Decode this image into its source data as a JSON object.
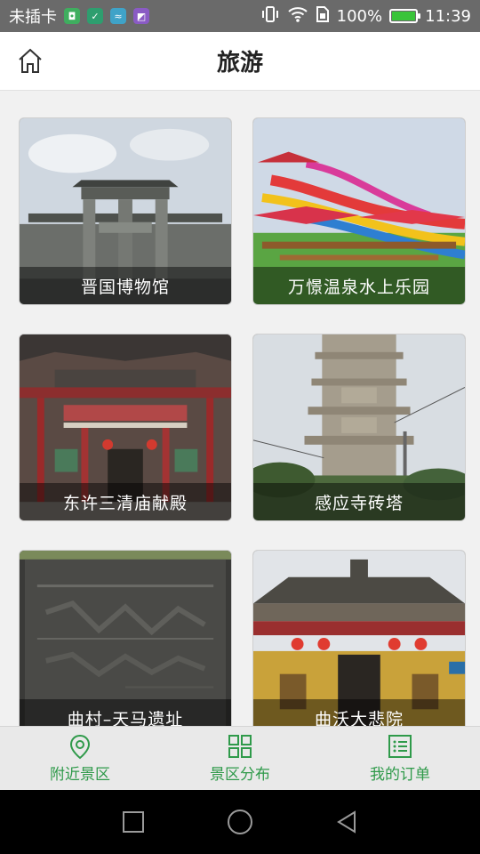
{
  "status_bar": {
    "carrier": "未插卡",
    "battery_text": "100%",
    "battery_level": 1.0,
    "time": "11:39",
    "app_icons": [
      "app-icon-green",
      "app-icon-green2",
      "app-icon-blue",
      "app-icon-purple"
    ]
  },
  "header": {
    "title": "旅游",
    "home_icon": "home-icon"
  },
  "attractions": [
    {
      "name": "晋国博物馆"
    },
    {
      "name": "万憬温泉水上乐园"
    },
    {
      "name": "东许三清庙献殿"
    },
    {
      "name": "感应寺砖塔"
    },
    {
      "name": "曲村–天马遗址"
    },
    {
      "name": "曲沃大悲院"
    }
  ],
  "tabs": [
    {
      "label": "附近景区",
      "icon": "location-pin-icon"
    },
    {
      "label": "景区分布",
      "icon": "grid-icon"
    },
    {
      "label": "我的订单",
      "icon": "list-icon"
    }
  ],
  "colors": {
    "accent": "#2f9a4a",
    "status_bar": "#6a6a6a",
    "content_bg": "#f1f1f1"
  }
}
